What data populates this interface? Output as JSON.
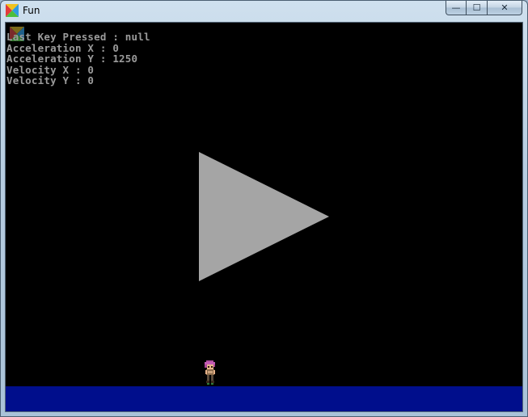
{
  "window": {
    "title": "Fun",
    "controls": {
      "minimize_glyph": "—",
      "maximize_glyph": "☐",
      "close_glyph": "✕"
    }
  },
  "hud": {
    "lines": [
      "Last Key Pressed : null",
      "Acceleration X : 0",
      "Acceleration Y : 1250",
      "Velocity X : 0",
      "Velocity Y : 0"
    ]
  },
  "colors": {
    "background": "#000000",
    "hud_text": "#9b9b9b",
    "play_triangle": "#a5a5a5",
    "ground": "#000e8c"
  },
  "icons": {
    "app": "app-logo-icon",
    "play": "play-triangle-icon",
    "player": "player-sprite"
  }
}
